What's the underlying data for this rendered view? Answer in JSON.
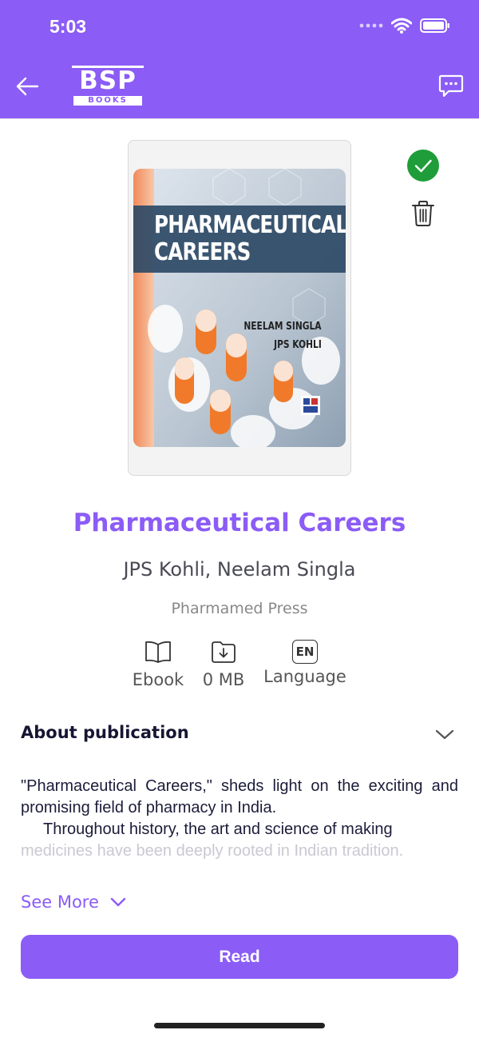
{
  "status_bar": {
    "time": "5:03",
    "icons": [
      "signal-dots-icon",
      "wifi-icon",
      "battery-icon"
    ]
  },
  "app_bar": {
    "back_icon": "arrow-left-icon",
    "logo_top": "BSP",
    "logo_bottom": "BOOKS",
    "chat_icon": "chat-bubble-icon"
  },
  "cover": {
    "title_line1": "PHARMACEUTICAL",
    "title_line2": "CAREERS",
    "author1": "NEELAM SINGLA",
    "author2": "JPS KOHLI"
  },
  "actions": {
    "downloaded_icon": "check-circle-icon",
    "delete_icon": "trash-icon"
  },
  "book": {
    "title": "Pharmaceutical Careers",
    "authors": "JPS Kohli, Neelam Singla",
    "publisher": "Pharmamed Press"
  },
  "meta": {
    "format_icon": "open-book-icon",
    "format": "Ebook",
    "size_icon": "folder-download-icon",
    "size": "0 MB",
    "language_badge": "EN",
    "language": "Language"
  },
  "about": {
    "title": "About publication",
    "line1": "\"Pharmaceutical Careers,\" sheds light on the exciting and promising field of pharmacy in India.",
    "line2": "Throughout history, the art and science of making",
    "line3": "medicines have been deeply rooted in Indian tradition."
  },
  "see_more": "See More",
  "read_button": "Read",
  "colors": {
    "accent": "#8b5cf6",
    "success": "#1f9d3a"
  }
}
